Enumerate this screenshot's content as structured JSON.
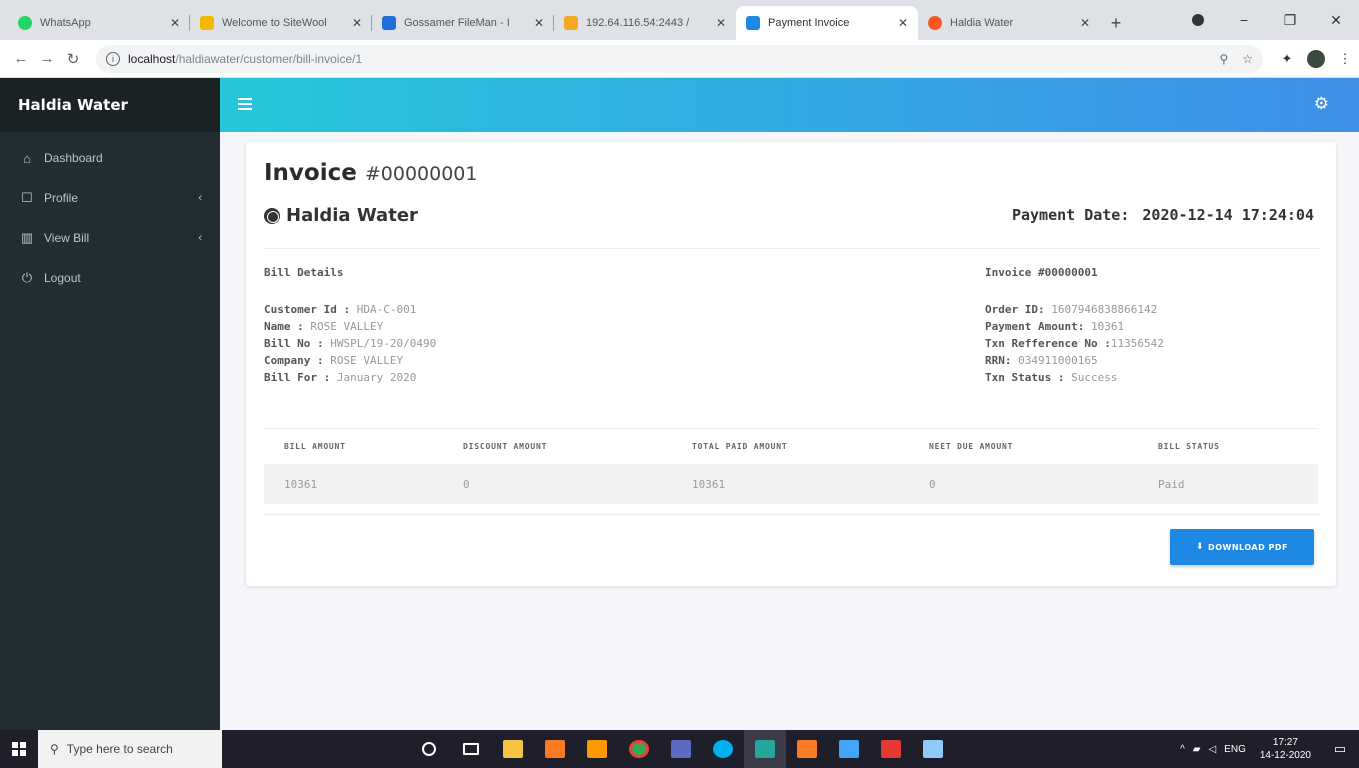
{
  "browser": {
    "tabs": [
      {
        "title": "WhatsApp",
        "color": "#25d366"
      },
      {
        "title": "Welcome to SiteWool",
        "color": "#f5b800"
      },
      {
        "title": "Gossamer FileMan - I",
        "color": "#1e6fd9"
      },
      {
        "title": "192.64.116.54:2443 / ",
        "color": "#f5a623"
      },
      {
        "title": "Payment Invoice",
        "color": "#1e88e5"
      },
      {
        "title": "Haldia Water",
        "color": "#ff5722"
      }
    ],
    "url_host": "localhost",
    "url_path": "/haldiawater/customer/bill-invoice/1"
  },
  "sidebar": {
    "brand": "Haldia Water",
    "items": [
      {
        "label": "Dashboard",
        "icon": "home-icon"
      },
      {
        "label": "Profile",
        "icon": "profile-icon"
      },
      {
        "label": "View Bill",
        "icon": "chart-icon"
      },
      {
        "label": "Logout",
        "icon": "power-icon"
      }
    ]
  },
  "invoice": {
    "title": "Invoice",
    "number": "#00000001",
    "company": "Haldia Water",
    "payment_date_label": "Payment Date:",
    "payment_date": "2020-12-14 17:24:04",
    "bill_details_title": "Bill Details",
    "customer_id_label": "Customer Id :",
    "customer_id": "HDA-C-001",
    "name_label": "Name :",
    "name": "ROSE VALLEY",
    "bill_no_label": "Bill No :",
    "bill_no": "HWSPL/19-20/0490",
    "company_label": "Company :",
    "company_value": "ROSE VALLEY",
    "bill_for_label": "Bill For :",
    "bill_for": "January 2020",
    "invoice_title": "Invoice #00000001",
    "order_id_label": "Order ID:",
    "order_id": "1607946838866142",
    "payment_amount_label": "Payment Amount:",
    "payment_amount": "10361",
    "txn_ref_label": "Txn Refference No :",
    "txn_ref": "11356542",
    "rrn_label": "RRN:",
    "rrn": "034911000165",
    "txn_status_label": "Txn Status :",
    "txn_status": "Success",
    "table": {
      "headers": [
        "BILL AMOUNT",
        "DISCOUNT AMOUNT",
        "TOTAL PAID AMOUNT",
        "NEET DUE AMOUNT",
        "BILL STATUS"
      ],
      "row": [
        "10361",
        "0",
        "10361",
        "0",
        "Paid"
      ]
    },
    "download_label": "DOWNLOAD PDF"
  },
  "taskbar": {
    "search_placeholder": "Type here to search",
    "lang": "ENG",
    "time": "17:27",
    "date": "14-12-2020"
  }
}
